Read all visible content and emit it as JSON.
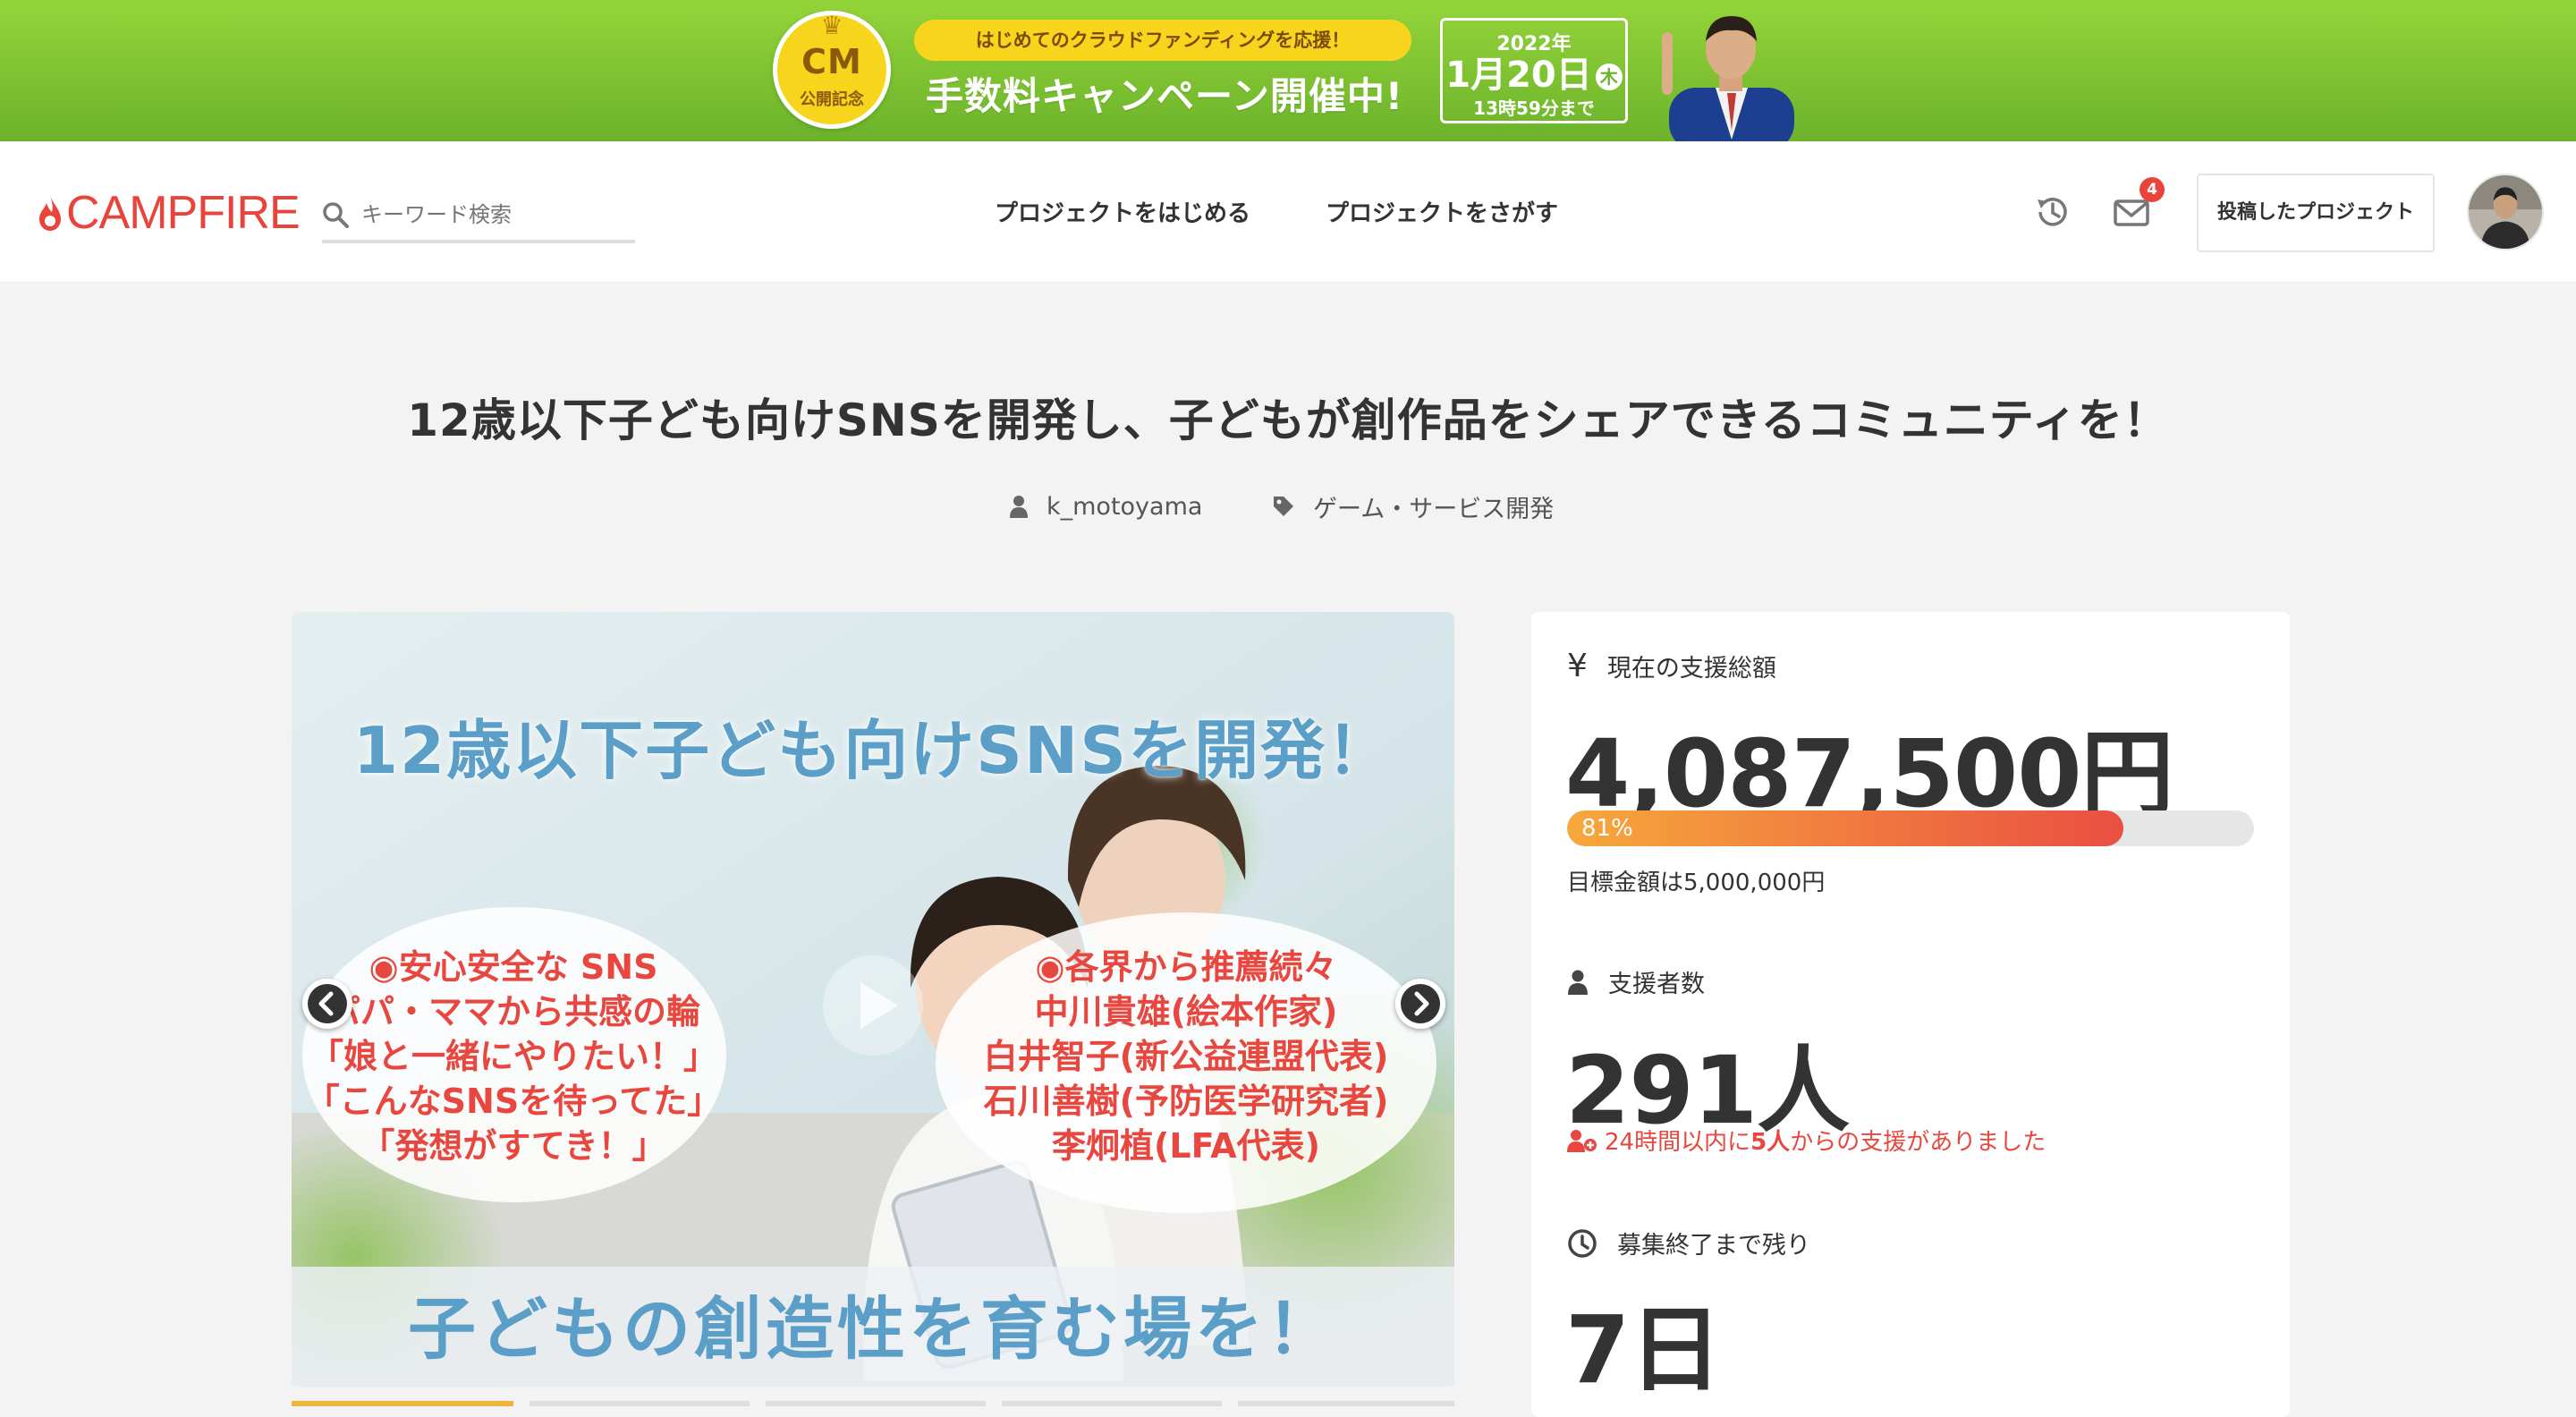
{
  "banner": {
    "cm_text": "CM",
    "cm_sub": "公開記念",
    "pill": "はじめてのクラウドファンディングを応援！",
    "main": "手数料キャンペーン開催中!",
    "date_year": "2022年",
    "date_day": "1月20日",
    "date_weekday": "木",
    "date_time": "13時59分まで"
  },
  "header": {
    "logo": "CAMPFIRE",
    "search_placeholder": "キーワード検索",
    "nav_start": "プロジェクトをはじめる",
    "nav_search": "プロジェクトをさがす",
    "mail_count": "4",
    "posted_projects": "投稿したプロジェクト"
  },
  "project": {
    "title": "12歳以下子ども向けSNSを開発し、子どもが創作品をシェアできるコミュニティを！",
    "author": "k_motoyama",
    "category": "ゲーム・サービス開発"
  },
  "hero": {
    "headline": "12歳以下子ども向けSNSを開発！",
    "left_bubble": [
      "◉安心安全な SNS",
      "パパ・ママから共感の輪",
      "「娘と一緒にやりたい！」",
      "「こんなSNSを待ってた」",
      "「発想がすてき！」"
    ],
    "right_bubble": [
      "◉各界から推薦続々",
      "中川貴雄(絵本作家)",
      "白井智子(新公益連盟代表)",
      "石川善樹(予防医学研究者)",
      "李炯植(LFA代表)"
    ],
    "footer": "子どもの創造性を育む場を！"
  },
  "stats": {
    "amount_label": "現在の支援総額",
    "amount": "4,087,500円",
    "progress_percent": 81,
    "progress_label": "81%",
    "goal": "目標金額は5,000,000円",
    "backers_label": "支援者数",
    "backers": "291人",
    "recent_prefix": "24時間以内に",
    "recent_count": "5人",
    "recent_suffix": "からの支援がありました",
    "remaining_label": "募集終了まで残り",
    "remaining": "7日"
  },
  "colors": {
    "brand_red": "#e8443b",
    "banner_green": "#7cc22f",
    "progress_start": "#f7a83c",
    "progress_end": "#e94f42"
  }
}
